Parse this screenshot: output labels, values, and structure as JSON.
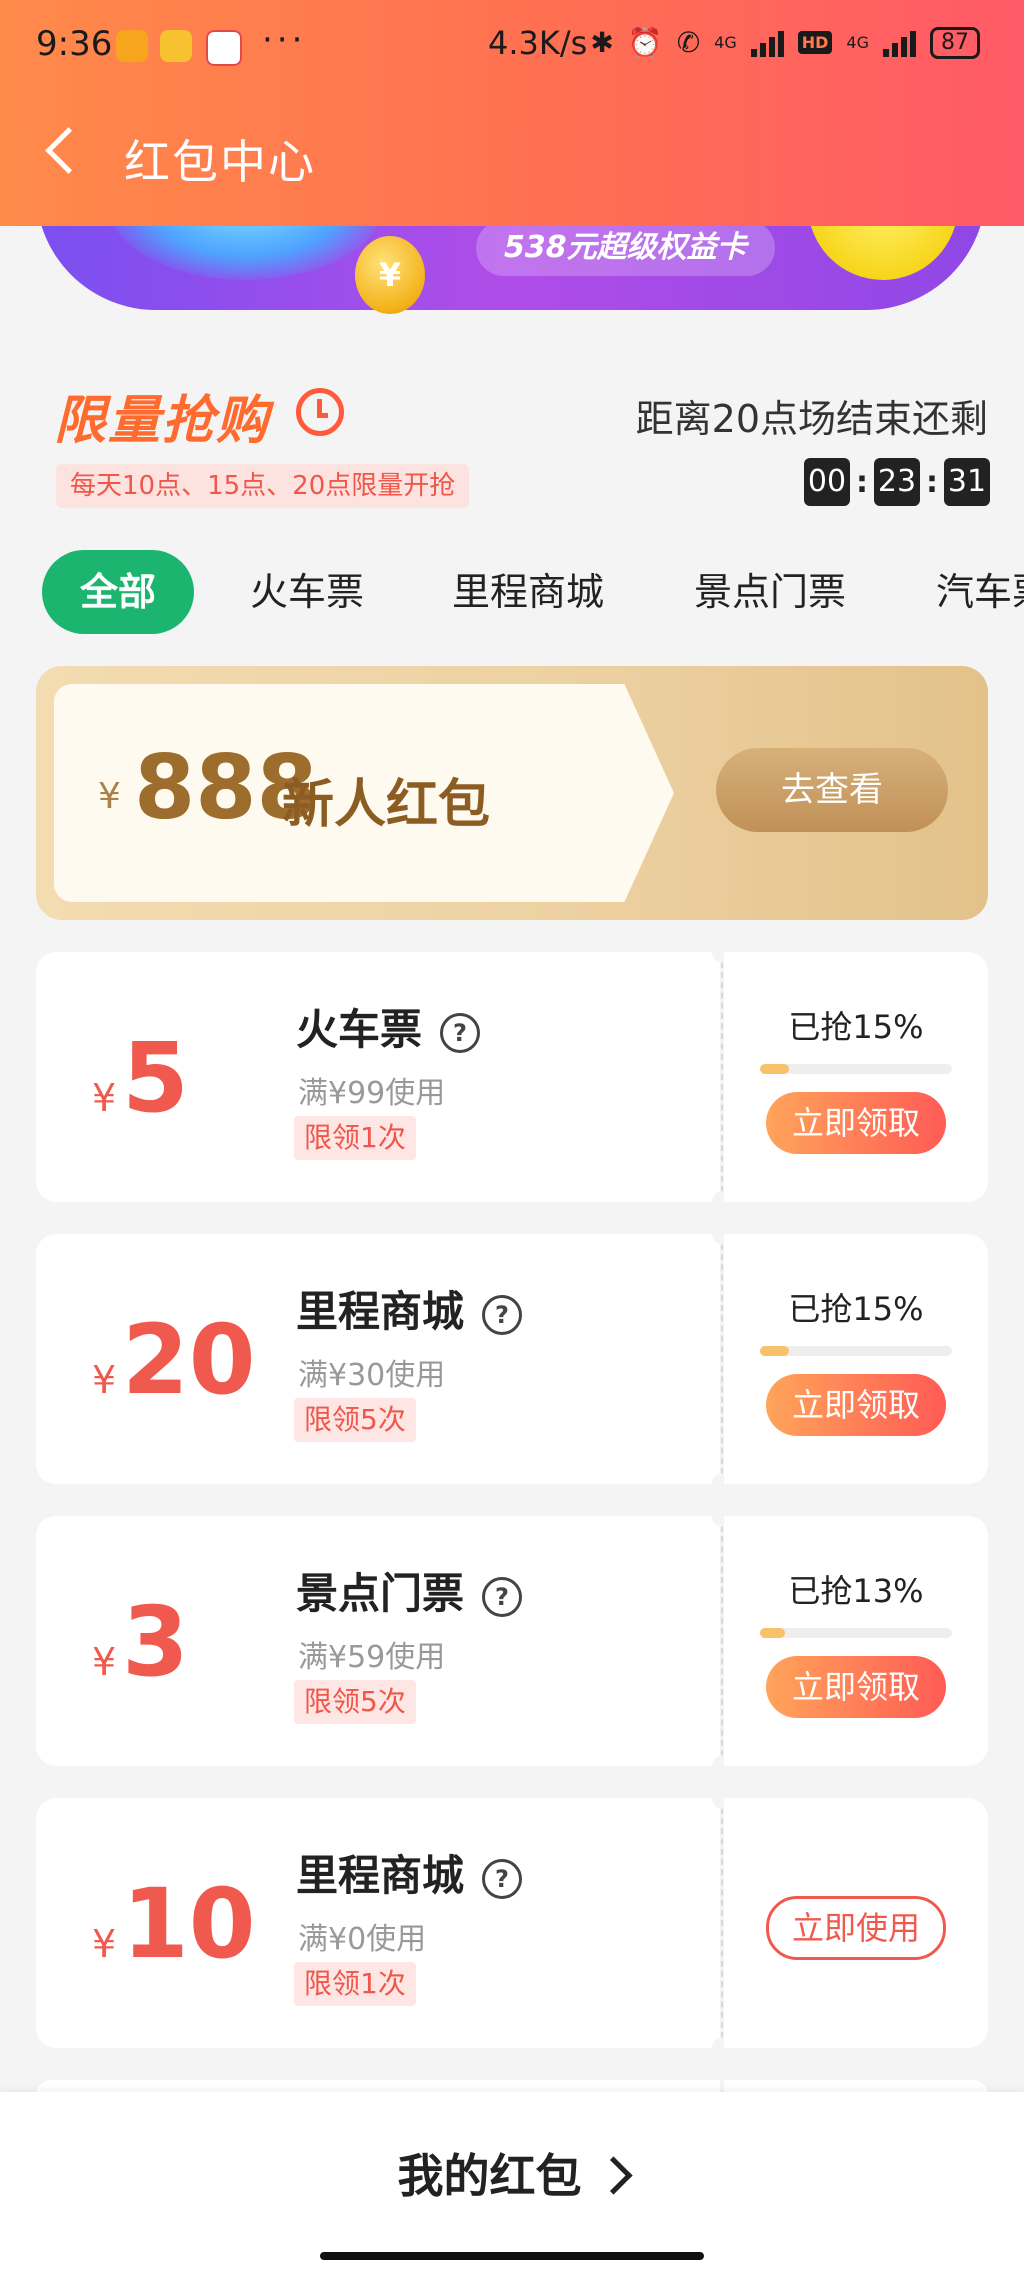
{
  "status_bar": {
    "time": "9:36",
    "dots": "···",
    "speed": "4.3K/s",
    "net1": "4G",
    "hd": "HD",
    "net2": "4G",
    "battery": "87"
  },
  "nav": {
    "title": "红包中心"
  },
  "banner": {
    "pill_text": "538元超级权益卡",
    "coin_symbol": "¥"
  },
  "flash_sale": {
    "title": "限量抢购",
    "subtitle": "每天10点、15点、20点限量开抢",
    "countdown_label": "距离20点场结束还剩",
    "countdown": {
      "hours": "00",
      "minutes": "23",
      "seconds": "31",
      "sep": ":"
    }
  },
  "tabs": [
    "全部",
    "火车票",
    "里程商城",
    "景点门票",
    "汽车票"
  ],
  "new_user": {
    "yen": "¥",
    "amount": "888",
    "label": "新人红包",
    "button": "去查看"
  },
  "coupons": [
    {
      "yen": "¥",
      "amount": "5",
      "title": "火车票",
      "qmark": "?",
      "condition": "满¥99使用",
      "limit": "限领1次",
      "progress_text": "已抢15%",
      "progress": 0.15,
      "button": "立即领取"
    },
    {
      "yen": "¥",
      "amount": "20",
      "title": "里程商城",
      "qmark": "?",
      "condition": "满¥30使用",
      "limit": "限领5次",
      "progress_text": "已抢15%",
      "progress": 0.15,
      "button": "立即领取"
    },
    {
      "yen": "¥",
      "amount": "3",
      "title": "景点门票",
      "qmark": "?",
      "condition": "满¥59使用",
      "limit": "限领5次",
      "progress_text": "已抢13%",
      "progress": 0.13,
      "button": "立即领取"
    },
    {
      "yen": "¥",
      "amount": "10",
      "title": "里程商城",
      "qmark": "?",
      "condition": "满¥0使用",
      "limit": "限领1次",
      "button": "立即使用"
    }
  ],
  "bottom_bar": {
    "label": "我的红包"
  }
}
